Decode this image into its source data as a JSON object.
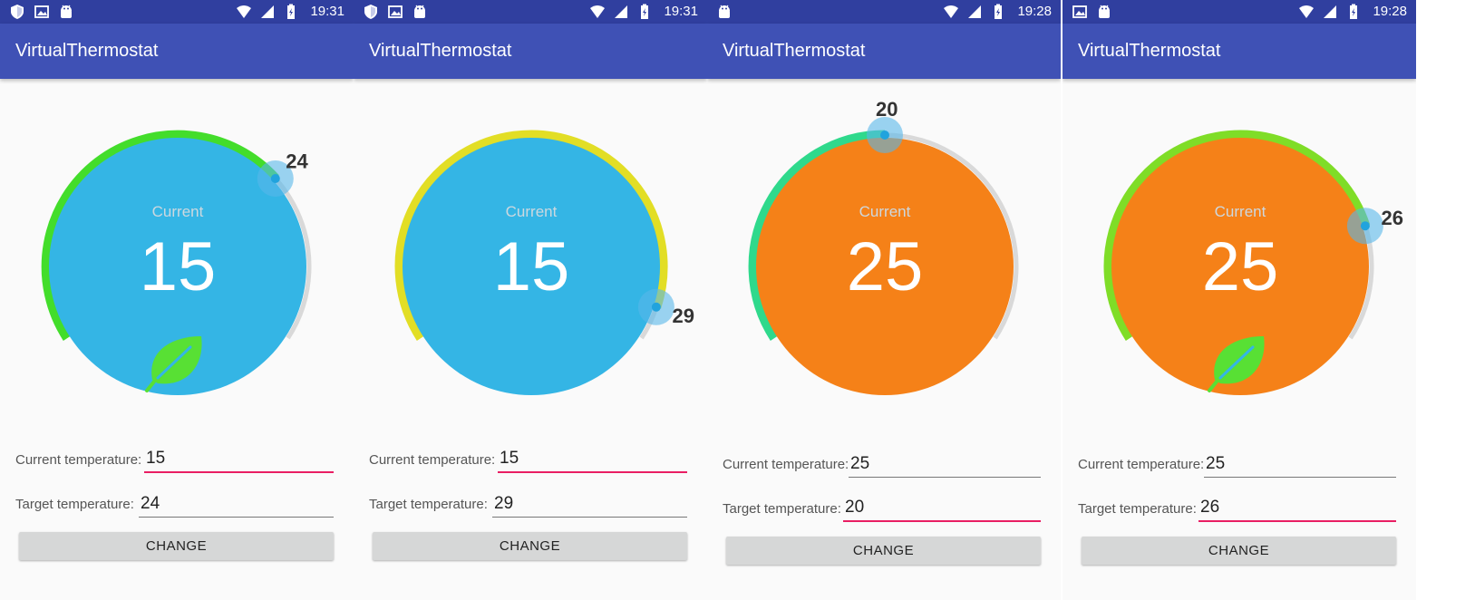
{
  "screens": [
    {
      "status": {
        "time": "19:31",
        "left_icons": [
          "shield-icon",
          "image-icon",
          "android-icon"
        ],
        "right_icons": [
          "wifi-icon",
          "signal-icon",
          "battery-icon"
        ]
      },
      "app_title": "VirtualThermostat",
      "dial": {
        "face_color": "#34b5e5",
        "arc_color": "#43dd2b",
        "label": "Current",
        "current": "15",
        "target": "24",
        "target_value": 24,
        "show_leaf": true
      },
      "fields": {
        "current_label": "Current temperature:",
        "current_value": "15",
        "target_label": "Target temperature:",
        "target_value": "24",
        "focused": "current"
      },
      "button_label": "CHANGE"
    },
    {
      "status": {
        "time": "19:31",
        "left_icons": [
          "shield-icon",
          "image-icon",
          "android-icon"
        ],
        "right_icons": [
          "wifi-icon",
          "signal-icon",
          "battery-icon"
        ]
      },
      "app_title": "VirtualThermostat",
      "dial": {
        "face_color": "#34b5e5",
        "arc_color": "#e2de25",
        "label": "Current",
        "current": "15",
        "target": "29",
        "target_value": 29,
        "show_leaf": false
      },
      "fields": {
        "current_label": "Current temperature:",
        "current_value": "15",
        "target_label": "Target temperature:",
        "target_value": "29",
        "focused": "current"
      },
      "button_label": "CHANGE"
    },
    {
      "status": {
        "time": "19:28",
        "left_icons": [
          "android-icon"
        ],
        "right_icons": [
          "wifi-icon",
          "signal-icon",
          "battery-icon"
        ]
      },
      "app_title": "VirtualThermostat",
      "dial": {
        "face_color": "#f58118",
        "arc_color": "#2fd98c",
        "label": "Current",
        "current": "25",
        "target": "20",
        "target_value": 20,
        "show_leaf": false
      },
      "fields": {
        "current_label": "Current temperature:",
        "current_value": "25",
        "target_label": "Target temperature:",
        "target_value": "20",
        "focused": "target"
      },
      "button_label": "CHANGE"
    },
    {
      "status": {
        "time": "19:28",
        "left_icons": [
          "image-icon",
          "android-icon"
        ],
        "right_icons": [
          "wifi-icon",
          "signal-icon",
          "battery-icon"
        ]
      },
      "app_title": "VirtualThermostat",
      "dial": {
        "face_color": "#f58118",
        "arc_color": "#7fdd27",
        "label": "Current",
        "current": "25",
        "target": "26",
        "target_value": 26,
        "show_leaf": true
      },
      "fields": {
        "current_label": "Current temperature:",
        "current_value": "25",
        "target_label": "Target temperature:",
        "target_value": "26",
        "focused": "target"
      },
      "button_label": "CHANGE"
    }
  ]
}
